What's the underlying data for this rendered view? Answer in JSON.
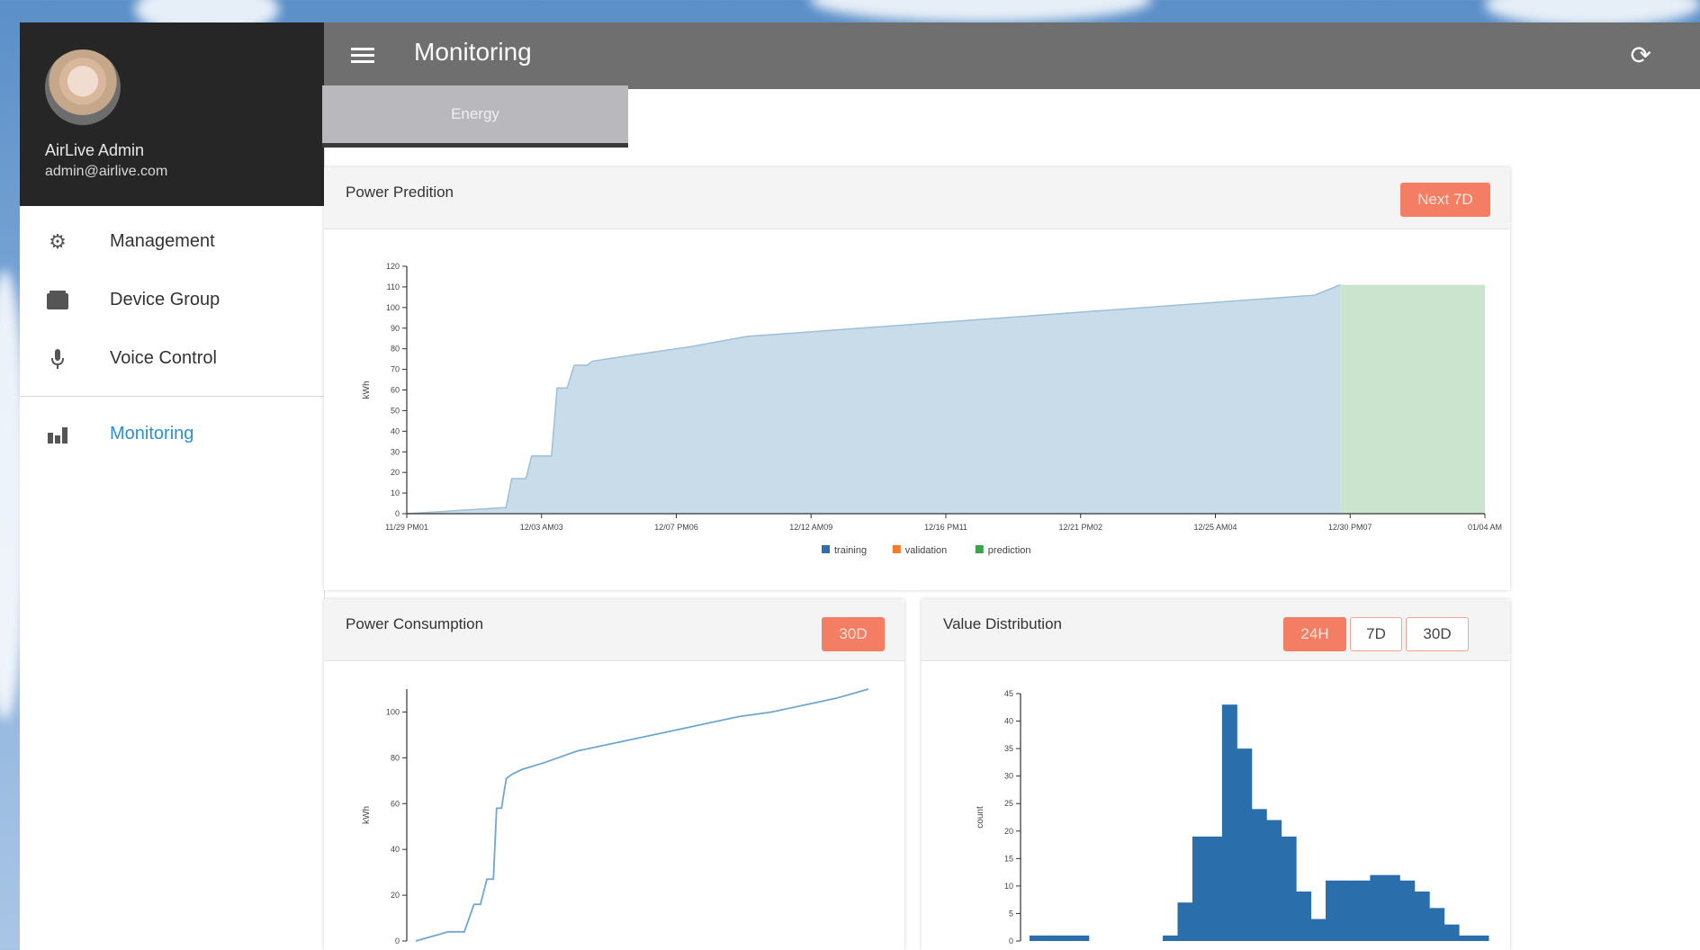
{
  "user": {
    "name": "AirLive Admin",
    "email": "admin@airlive.com"
  },
  "sidebar": {
    "items": [
      {
        "label": "Management",
        "icon": "gear-icon"
      },
      {
        "label": "Device Group",
        "icon": "folder-icon"
      },
      {
        "label": "Voice Control",
        "icon": "microphone-icon"
      },
      {
        "label": "Monitoring",
        "icon": "bar-chart-icon",
        "active": true
      }
    ]
  },
  "header": {
    "title": "Monitoring"
  },
  "tabs": [
    {
      "label": "Energy",
      "active": true
    }
  ],
  "colors": {
    "accent": "#f47e63",
    "link": "#2f8fd3",
    "training": "#2f6fb0",
    "validation": "#f07c2c",
    "prediction": "#3ea34b"
  },
  "prediction_card": {
    "title": "Power Predition",
    "button": "Next 7D"
  },
  "consumption_card": {
    "title": "Power Consumption",
    "button": "30D"
  },
  "distribution_card": {
    "title": "Value Distribution",
    "buttons": [
      "24H",
      "7D",
      "30D"
    ]
  },
  "chart_data": [
    {
      "type": "area",
      "ylabel": "kWh",
      "ylim": [
        0,
        120
      ],
      "yticks": [
        0,
        10,
        20,
        30,
        40,
        50,
        60,
        70,
        80,
        90,
        100,
        110,
        120
      ],
      "xticks": [
        "11/29 PM01",
        "12/03 AM03",
        "12/07 PM06",
        "12/12 AM09",
        "12/16 PM11",
        "12/21 PM02",
        "12/25 AM04",
        "12/30 PM07",
        "01/04 AM"
      ],
      "xlim": [
        0,
        36
      ],
      "legend": [
        "training",
        "validation",
        "prediction"
      ],
      "series": [
        {
          "name": "training",
          "x": [
            0,
            7,
            7.4,
            8.4,
            8.8,
            10.2,
            10.6,
            11.3,
            11.8,
            12.7,
            13.1,
            16,
            20,
            24,
            28,
            32,
            36,
            40,
            44,
            48,
            52,
            56,
            60,
            64,
            65.8
          ],
          "y": [
            0,
            3,
            17,
            17,
            28,
            28,
            61,
            61,
            72,
            72,
            74,
            77,
            81,
            86,
            88,
            90,
            92,
            94,
            96,
            98,
            100,
            102,
            104,
            106,
            111
          ]
        },
        {
          "name": "prediction",
          "x": [
            65.8,
            76
          ],
          "y": [
            111,
            111
          ]
        }
      ]
    },
    {
      "type": "line",
      "ylabel": "kWh",
      "ylim": [
        0,
        110
      ],
      "yticks": [
        0,
        20,
        40,
        60,
        80,
        100
      ],
      "series": [
        {
          "name": "consumption",
          "x": [
            0,
            2,
            3,
            3.6,
            4,
            4.4,
            4.8,
            5,
            5.3,
            5.6,
            6,
            6.6,
            8,
            10,
            12,
            14,
            16,
            18,
            20,
            22,
            24,
            26,
            28
          ],
          "y": [
            0,
            4,
            4,
            16,
            16,
            27,
            27,
            58,
            58,
            71,
            73,
            75,
            78,
            83,
            86,
            89,
            92,
            95,
            98,
            100,
            103,
            106,
            110
          ]
        }
      ]
    },
    {
      "type": "bar",
      "ylabel": "count",
      "ylim": [
        0,
        45
      ],
      "yticks": [
        0,
        5,
        10,
        15,
        20,
        25,
        30,
        35,
        40,
        45
      ],
      "values": [
        1,
        1,
        1,
        1,
        0,
        0,
        0,
        0,
        0,
        1,
        7,
        19,
        19,
        43,
        35,
        24,
        22,
        19,
        9,
        4,
        11,
        11,
        11,
        12,
        12,
        11,
        9,
        6,
        3,
        1,
        1
      ]
    }
  ]
}
